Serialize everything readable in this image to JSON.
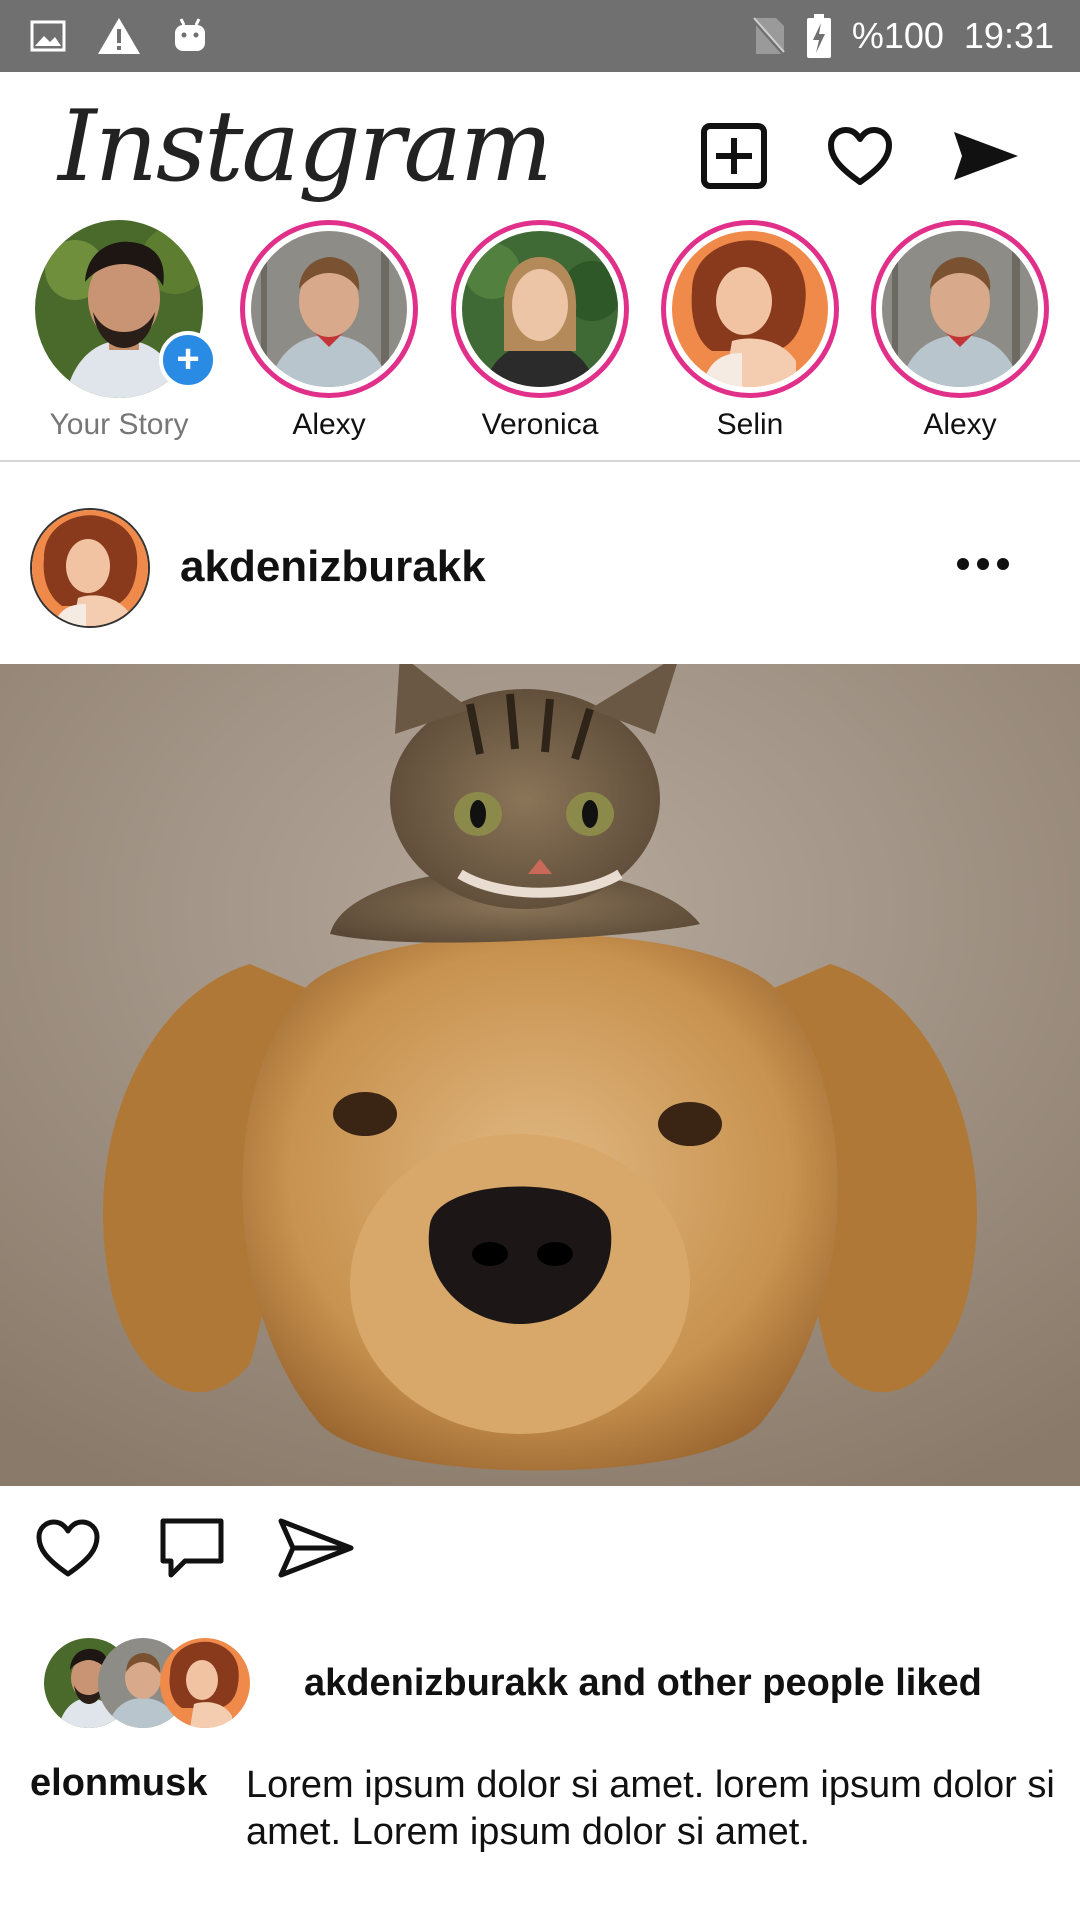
{
  "status_bar": {
    "left_icons": [
      "image-icon",
      "warning-icon",
      "android-icon"
    ],
    "right_icons": [
      "no-sim-icon",
      "battery-charging-icon"
    ],
    "battery": "%100",
    "time": "19:31"
  },
  "header": {
    "logo": "Instagram",
    "actions": [
      "add-post-icon",
      "heart-icon",
      "send-icon"
    ]
  },
  "stories": [
    {
      "name": "Your Story",
      "own": true
    },
    {
      "name": "Alexy",
      "own": false
    },
    {
      "name": "Veronica",
      "own": false
    },
    {
      "name": "Selin",
      "own": false
    },
    {
      "name": "Alexy",
      "own": false
    }
  ],
  "post": {
    "username": "akdenizburakk",
    "image_alt_subject": "kitten-on-golden-retriever",
    "actions": [
      "like-icon",
      "comment-icon",
      "share-icon"
    ],
    "likes_text": "akdenizburakk and other people liked",
    "caption_user": "elonmusk",
    "caption_text": "Lorem ipsum dolor si amet. lorem ipsum dolor si amet. Lorem ipsum dolor si amet."
  },
  "colors": {
    "status_bar": "#707070",
    "story_ring": "#e0308a",
    "add_badge": "#2a8be5"
  }
}
